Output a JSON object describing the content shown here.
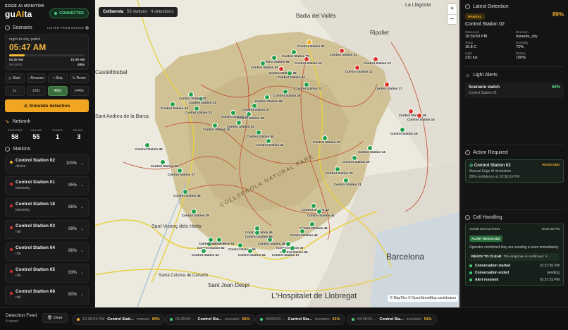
{
  "brand": {
    "subtitle": "EDGE AI MONITOR",
    "name_pre": "gu",
    "name_hl": "AI",
    "name_post": "ta",
    "connection": "CONNECTED"
  },
  "scenario": {
    "header": "Scenario",
    "listen": "LISTEN FROM DEVICE",
    "name": "night-to-day patrol",
    "time": "05:47 AM",
    "start_time": "04:30 AM",
    "end_time": "10:30 AM",
    "status": "PAUSED",
    "count": "480x",
    "progress": 0.21
  },
  "controls": {
    "start": "Start",
    "resume": "Resume",
    "skip": "Skip",
    "reset": "Reset"
  },
  "speeds": [
    "1x",
    "120x",
    "480x",
    "1440x"
  ],
  "speed_selected": "480x",
  "simulate_label": "Simulate detection",
  "network": {
    "header": "Network",
    "stats": [
      {
        "label": "STATIONS",
        "value": "58"
      },
      {
        "label": "ONLINE",
        "value": "55"
      },
      {
        "label": "ZONES",
        "value": "1"
      },
      {
        "label": "TELEG...",
        "value": "3"
      }
    ]
  },
  "stations_header": "Stations",
  "stations": [
    {
      "name": "Control Station 02",
      "sub": "device",
      "pct": "100%",
      "color": "#f0b12a"
    },
    {
      "name": "Control Station 01",
      "sub": "telemetry",
      "pct": "95%",
      "color": "#d9342b"
    },
    {
      "name": "Control Station 18",
      "sub": "telemetry",
      "pct": "86%",
      "color": "#d9342b"
    },
    {
      "name": "Control Station 03",
      "sub": "risk",
      "pct": "89%",
      "color": "#d9342b"
    },
    {
      "name": "Control Station 04",
      "sub": "risk",
      "pct": "86%",
      "color": "#d9342b"
    },
    {
      "name": "Control Station 05",
      "sub": "risk",
      "pct": "83%",
      "color": "#d9342b"
    },
    {
      "name": "Control Station 06",
      "sub": "risk",
      "pct": "80%",
      "color": "#d9342b"
    }
  ],
  "map": {
    "location": "Collserola",
    "stations": "58 stations",
    "detections": "4 detections",
    "zoom_in": "+",
    "zoom_out": "−",
    "attribution": "© MapTiler © OpenStreetMap contributors",
    "park_label": "COLLSEROLA NATURAL PARK",
    "cities": [
      "Badia del Vallès",
      "La Llagosta",
      "Ripollet",
      "Castellbisbal",
      "Sant Andreu de la Barca",
      "Sant Vicenç dels Horts",
      "Santa Coloma de Cervelló",
      "Sant Joan Despí",
      "L'Hospitalet de Llobregat",
      "Barcelona"
    ],
    "label_prefix": "Control Station "
  },
  "latest": {
    "header": "Latest Detection",
    "tag": "MANUAL",
    "pct": "89%",
    "station": "Control Station 02",
    "fields": [
      {
        "label": "Observed",
        "value": "10:36:53 PM"
      },
      {
        "label": "Direction",
        "value": "towards_city"
      },
      {
        "label": "Temp",
        "value": "16.8 C"
      },
      {
        "label": "Humidity",
        "value": "72%"
      },
      {
        "label": "Light",
        "value": "310 lux"
      },
      {
        "label": "Battery",
        "value": "100%"
      }
    ]
  },
  "light_alerts": {
    "header": "Light Alerts",
    "title": "Scenario watch",
    "pct": "66%",
    "station": "Control Station 01"
  },
  "action": {
    "header": "Action Required",
    "station": "Control Station 02",
    "status": "RESOLVED",
    "line1": "Manual Edge AI simulation",
    "line2": "89% confidence at 10:36:53 PM"
  },
  "call": {
    "header": "Call Handling",
    "escalation": "VOICE ESCALATION",
    "esc_time": "10:37:25 PM",
    "badge": "ALERT RESOLVED",
    "message": "Operator confirmed they are sending a team immediately.",
    "ready": "READY TO CLEAR",
    "ready_text": "The response is confirmed. Y...",
    "events": [
      {
        "label": "Conversation started",
        "time": "10:37:00 PM"
      },
      {
        "label": "Conversation ended",
        "time": "pending"
      },
      {
        "label": "Alert resolved",
        "time": "10:37:25 PM"
      }
    ]
  },
  "feed": {
    "label": "Detection Feed",
    "sub": "4 stored",
    "clear": "Clear",
    "items": [
      {
        "time": "10:36:53 PM",
        "name": "Control Stati...",
        "type": "manual",
        "pct": "89%",
        "color": "#f0b12a"
      },
      {
        "time": "05:25:00 ...",
        "name": "Control Sta...",
        "type": "scenario",
        "pct": "66%",
        "color": "#45d07a"
      },
      {
        "time": "04:58:00 ...",
        "name": "Control Sta...",
        "type": "scenario",
        "pct": "61%",
        "color": "#45d07a"
      },
      {
        "time": "04:38:00 ...",
        "name": "Control Sta...",
        "type": "scenario",
        "pct": "54%",
        "color": "#45d07a"
      }
    ]
  }
}
